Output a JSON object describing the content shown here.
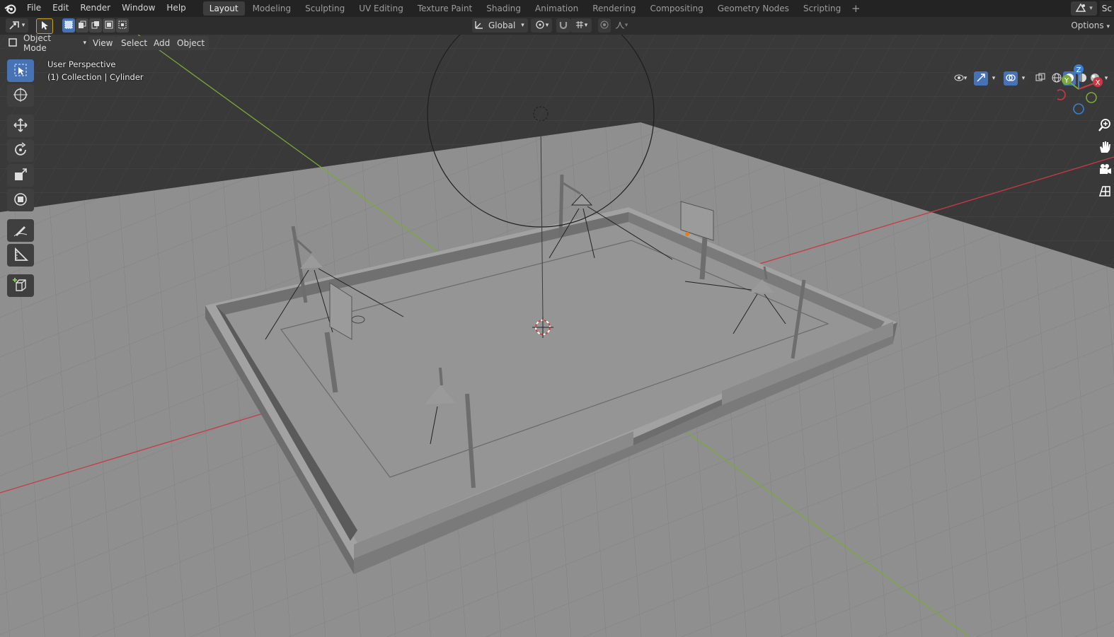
{
  "app": {
    "menus": [
      "File",
      "Edit",
      "Render",
      "Window",
      "Help"
    ]
  },
  "workspaces": {
    "tabs": [
      "Layout",
      "Modeling",
      "Sculpting",
      "UV Editing",
      "Texture Paint",
      "Shading",
      "Animation",
      "Rendering",
      "Compositing",
      "Geometry Nodes",
      "Scripting"
    ],
    "active": "Layout",
    "add_label": "+"
  },
  "topright": {
    "scene_label": "Sc"
  },
  "tool_header": {
    "orientation": "Global",
    "options_label": "Options"
  },
  "view_header": {
    "mode": "Object Mode",
    "menus": [
      "View",
      "Select",
      "Add",
      "Object"
    ]
  },
  "viewport": {
    "perspective_label": "User Perspective",
    "collection_label": "(1) Collection | Cylinder",
    "gizmo_axes": {
      "z": "Z",
      "y": "Y",
      "x": "X"
    }
  },
  "colors": {
    "accent": "#4772b3",
    "x_axis": "#c83a45",
    "y_axis": "#7aa83a",
    "z_axis": "#3a7fd0",
    "background": "#393939",
    "floor": "#8f8f8f"
  },
  "icons": {
    "toolbar": [
      "select-box-icon",
      "cursor-icon",
      "move-icon",
      "rotate-icon",
      "scale-icon",
      "transform-icon",
      "annotate-icon",
      "measure-icon",
      "add-cube-icon"
    ],
    "nav": [
      "zoom-icon",
      "pan-hand-icon",
      "camera-icon",
      "ortho-grid-icon"
    ]
  }
}
